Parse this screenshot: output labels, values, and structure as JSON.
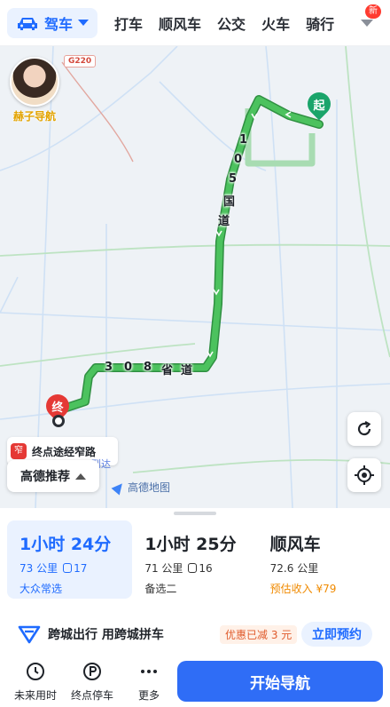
{
  "topbar": {
    "mode_label": "驾车",
    "tabs": [
      "打车",
      "顺风车",
      "公交",
      "火车",
      "骑行"
    ],
    "new_badge": "新"
  },
  "map": {
    "avatar_label": "赫子导航",
    "road_shield": "G220",
    "start_marker": "起",
    "end_marker": "终",
    "road_105": [
      "1",
      "0",
      "5",
      "国",
      "道"
    ],
    "road_308": [
      "3",
      "0",
      "8",
      "省",
      "道"
    ],
    "notice_text": "终点途经窄路",
    "notice_sub": "到达",
    "notice_icon_char": "窄",
    "recommend_label": "高德推荐",
    "watermark": "高德地图",
    "route_color": "#3cb64f"
  },
  "routes": [
    {
      "time": "1小时 24分",
      "distance": "73 公里",
      "lights": "17",
      "tag": "大众常选",
      "active": true
    },
    {
      "time": "1小时 25分",
      "distance": "71 公里",
      "lights": "16",
      "tag": "备选二",
      "active": false
    },
    {
      "time": "顺风车",
      "distance": "72.6 公里",
      "lights": "",
      "tag": "预估收入 ¥79",
      "active": false
    }
  ],
  "promo": {
    "text": "跨城出行 用跨城拼车",
    "discount": "优惠已减 3 元",
    "book_label": "立即预约"
  },
  "actions": {
    "future": "未来用时",
    "parking": "终点停车",
    "more": "更多",
    "start_nav": "开始导航"
  },
  "colors": {
    "accent": "#1f6bff",
    "start_button": "#2f6df6",
    "route_green": "#3cb64f"
  }
}
